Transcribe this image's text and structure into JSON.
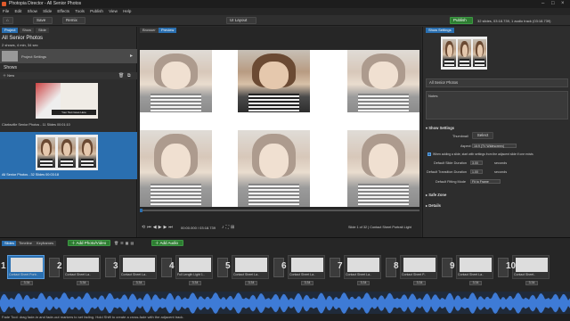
{
  "window": {
    "title": "Photopia Director - All Senior Photos"
  },
  "menu": [
    "File",
    "Edit",
    "Show",
    "Slide",
    "Effects",
    "Tools",
    "Publish",
    "View",
    "Help"
  ],
  "toolbar": {
    "save": "Save",
    "remix": "Remix",
    "layout": "UI Layout",
    "publish": "Publish",
    "summary": "32 slides, 03:18.739, 1 audio track (03:18.739)"
  },
  "left": {
    "tabs": [
      "Project",
      "Show",
      "Slide"
    ],
    "project_name": "All Senior Photos",
    "project_meta": "2 shows, 4 min, 34 sec",
    "project_settings": "Project Settings",
    "shows_label": "Shows",
    "new_label": "New",
    "show1_label": "Clarksville Senior Photos - 11 Slides  00:01:10",
    "show1_overlay": "Your Text Goes Here",
    "show2_label": "All Senior Photos - 32 Slides  00:03:18"
  },
  "center": {
    "tabs": [
      "Browser",
      "Preview"
    ],
    "time": "00:00.000 / 03:18.739",
    "slide_info": "Slide 1 of 32 | Contact Sheet Portrait Light"
  },
  "right": {
    "tab": "Show Settings",
    "show_name": "All Senior Photos",
    "notes_label": "Notes",
    "show_settings": "Show Settings",
    "thumbnail_label": "Thumbnail",
    "select_btn": "Select",
    "aspect_label": "Aspect Ratio",
    "aspect_value": "16:9 (TV Widescreen)",
    "checkbox_text": "When adding a slide, start with settings from the adjacent slide if one exists",
    "slide_dur_label": "Default Slide Duration",
    "slide_dur_value": "3.00",
    "trans_dur_label": "Default Transition Duration",
    "trans_dur_value": "1.00",
    "seconds": "seconds",
    "fitting_label": "Default Fitting Mode",
    "fitting_value": "Fit to Frame",
    "safe_zone": "Safe Zone",
    "details": "Details"
  },
  "timeline": {
    "tabs": [
      "Slides",
      "Timeline",
      "Keyframes"
    ],
    "add_photo": "Add Photo/Video",
    "add_audio": "Add Audio",
    "clips": [
      {
        "num": "1",
        "label": "Contact Sheet Portr..",
        "dur": "3.34"
      },
      {
        "num": "2",
        "label": "Contact Sheet La..",
        "dur": "3.34"
      },
      {
        "num": "3",
        "label": "Contact Sheet La..",
        "dur": "3.34"
      },
      {
        "num": "4",
        "label": "Full Length Light 1..",
        "dur": "3.34"
      },
      {
        "num": "5",
        "label": "Contact Sheet La..",
        "dur": "3.34"
      },
      {
        "num": "6",
        "label": "Contact Sheet La..",
        "dur": "3.34"
      },
      {
        "num": "7",
        "label": "Contact Sheet La..",
        "dur": "3.34"
      },
      {
        "num": "8",
        "label": "Contact Sheet P..",
        "dur": "3.34"
      },
      {
        "num": "9",
        "label": "Contact Sheet La..",
        "dur": "3.34"
      },
      {
        "num": "10",
        "label": "Contact Sheet..",
        "dur": "3.34"
      }
    ]
  },
  "status": "Fade Tool: drag fade-in and fade-out markers to set fading. Hold Shift to create a cross-fade with the adjacent track.",
  "colors": {
    "accent": "#2a6fb0",
    "publish": "#2e7d32",
    "waveform": "#3e7bd6"
  }
}
